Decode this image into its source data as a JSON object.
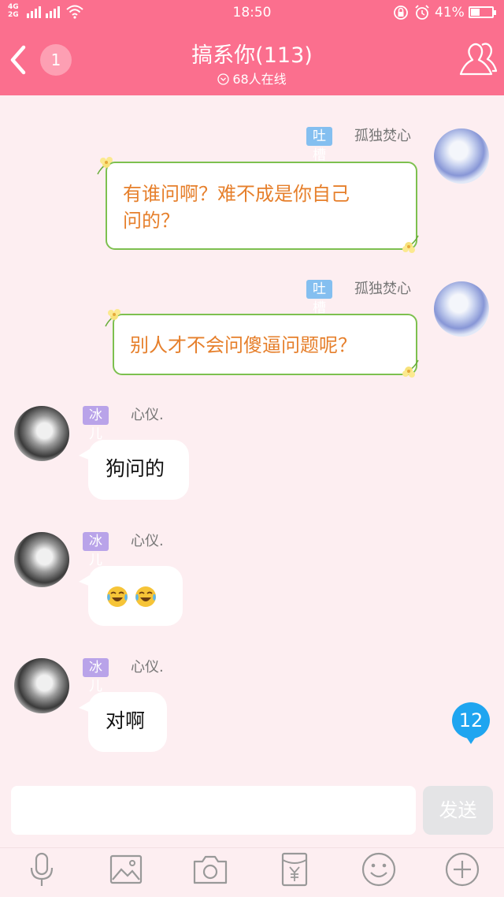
{
  "status_bar": {
    "network_top": "4G",
    "network_bottom": "2G",
    "network_top2": "2G",
    "time": "18:50",
    "battery_percent": "41%",
    "battery_level": 0.41
  },
  "header": {
    "unread_count": "1",
    "title": "搞系你(113)",
    "online": "68人在线"
  },
  "messages": [
    {
      "side": "right",
      "tag": "吐槽",
      "nickname": "孤独焚心",
      "text_line1": "有谁问啊？难不成是你自己",
      "text_line2": "问的？"
    },
    {
      "side": "right",
      "tag": "吐槽",
      "nickname": "孤独焚心",
      "text_line1": "别人才不会问傻逼问题呢？"
    },
    {
      "side": "left",
      "tag": "冰儿",
      "nickname": "心仪.",
      "text": "狗问的"
    },
    {
      "side": "left",
      "tag": "冰儿",
      "nickname": "心仪.",
      "emoji": [
        "tears-of-joy",
        "tears-of-joy"
      ]
    },
    {
      "side": "left",
      "tag": "冰儿",
      "nickname": "心仪.",
      "text": "对啊"
    }
  ],
  "new_messages_badge": "12",
  "input": {
    "placeholder": "",
    "value": "",
    "send_label": "发送"
  },
  "toolbar": [
    "microphone-icon",
    "image-icon",
    "camera-icon",
    "red-packet-icon",
    "emoji-icon",
    "plus-icon"
  ],
  "colors": {
    "header": "#fb6f8e",
    "background": "#fdeef1",
    "tag_blue": "#84bff0",
    "tag_purple": "#b9a3e9",
    "fancy_text": "#e67f2b",
    "fancy_border": "#7dc04f",
    "badge": "#1fa5f0"
  }
}
